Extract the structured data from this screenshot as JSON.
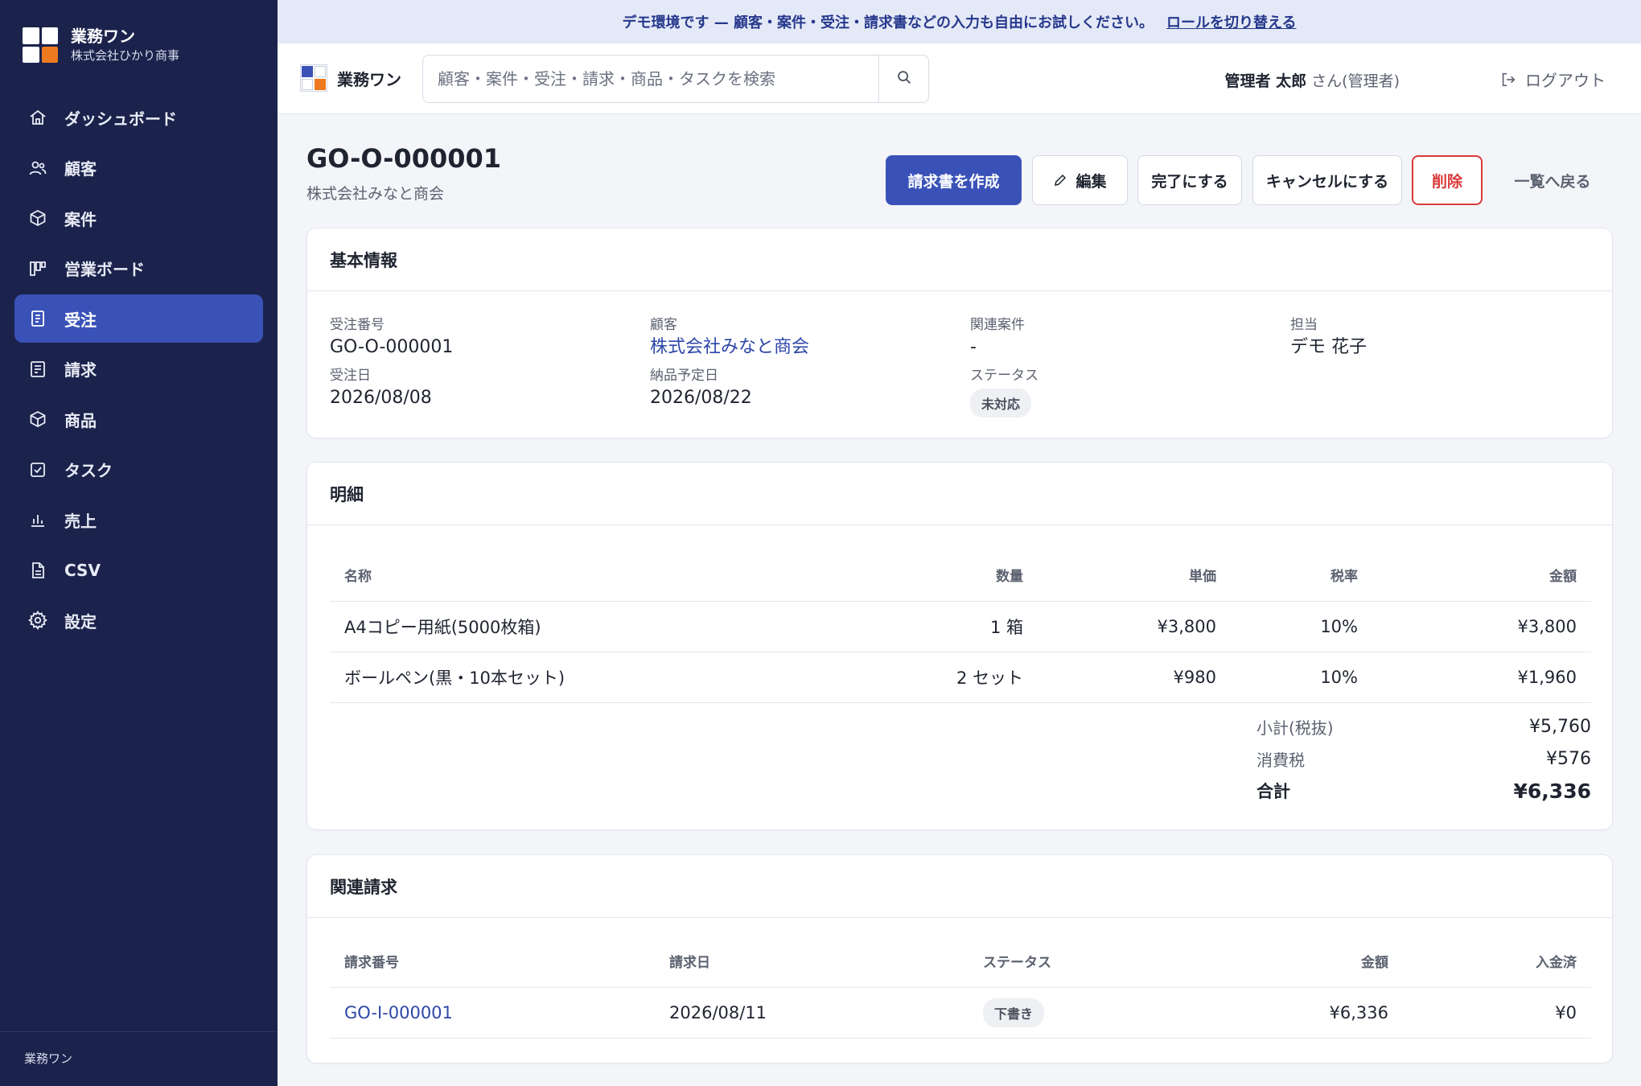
{
  "banner": {
    "text": "デモ環境です — 顧客・案件・受注・請求書などの入力も自由にお試しください。",
    "link": "ロールを切り替える"
  },
  "sidebar": {
    "app_name": "業務ワン",
    "company": "株式会社ひかり商事",
    "items": [
      {
        "label": "ダッシュボード",
        "icon": "home-icon"
      },
      {
        "label": "顧客",
        "icon": "users-icon"
      },
      {
        "label": "案件",
        "icon": "box-icon"
      },
      {
        "label": "営業ボード",
        "icon": "board-icon"
      },
      {
        "label": "受注",
        "icon": "receipt-icon"
      },
      {
        "label": "請求",
        "icon": "invoice-icon"
      },
      {
        "label": "商品",
        "icon": "package-icon"
      },
      {
        "label": "タスク",
        "icon": "check-icon"
      },
      {
        "label": "売上",
        "icon": "chart-icon"
      },
      {
        "label": "CSV",
        "icon": "file-icon"
      },
      {
        "label": "設定",
        "icon": "gear-icon"
      }
    ],
    "footer": "業務ワン"
  },
  "header": {
    "app_name": "業務ワン",
    "search_placeholder": "顧客・案件・受注・請求・商品・タスクを検索",
    "user_name": "管理者 太郎",
    "user_role": "さん(管理者)",
    "logout": "ログアウト"
  },
  "page": {
    "title": "GO-O-000001",
    "subtitle": "株式会社みなと商会",
    "actions": {
      "create_invoice": "請求書を作成",
      "edit": "編集",
      "complete": "完了にする",
      "cancel": "キャンセルにする",
      "delete": "削除",
      "back": "一覧へ戻る"
    }
  },
  "basic_info": {
    "title": "基本情報",
    "order_no_label": "受注番号",
    "order_no": "GO-O-000001",
    "customer_label": "顧客",
    "customer": "株式会社みなと商会",
    "related_label": "関連案件",
    "related": "-",
    "owner_label": "担当",
    "owner": "デモ 花子",
    "order_date_label": "受注日",
    "order_date": "2026/08/08",
    "delivery_label": "納品予定日",
    "delivery": "2026/08/22",
    "status_label": "ステータス",
    "status": "未対応"
  },
  "details": {
    "title": "明細",
    "headers": {
      "name": "名称",
      "qty": "数量",
      "price": "単価",
      "tax": "税率",
      "amount": "金額"
    },
    "rows": [
      {
        "name": "A4コピー用紙(5000枚箱)",
        "qty": "1 箱",
        "price": "¥3,800",
        "tax": "10%",
        "amount": "¥3,800"
      },
      {
        "name": "ボールペン(黒・10本セット)",
        "qty": "2 セット",
        "price": "¥980",
        "tax": "10%",
        "amount": "¥1,960"
      }
    ],
    "subtotal_label": "小計(税抜)",
    "subtotal": "¥5,760",
    "tax_label": "消費税",
    "tax": "¥576",
    "total_label": "合計",
    "total": "¥6,336"
  },
  "related_invoices": {
    "title": "関連請求",
    "headers": {
      "no": "請求番号",
      "date": "請求日",
      "status": "ステータス",
      "amount": "金額",
      "paid": "入金済"
    },
    "rows": [
      {
        "no": "GO-I-000001",
        "date": "2026/08/11",
        "status": "下書き",
        "amount": "¥6,336",
        "paid": "¥0"
      }
    ]
  },
  "colors": {
    "sidebar": "#1b234c",
    "primary": "#3a52b8",
    "accent": "#ee7a1f",
    "danger": "#d93a3a",
    "link": "#2d46a8"
  }
}
